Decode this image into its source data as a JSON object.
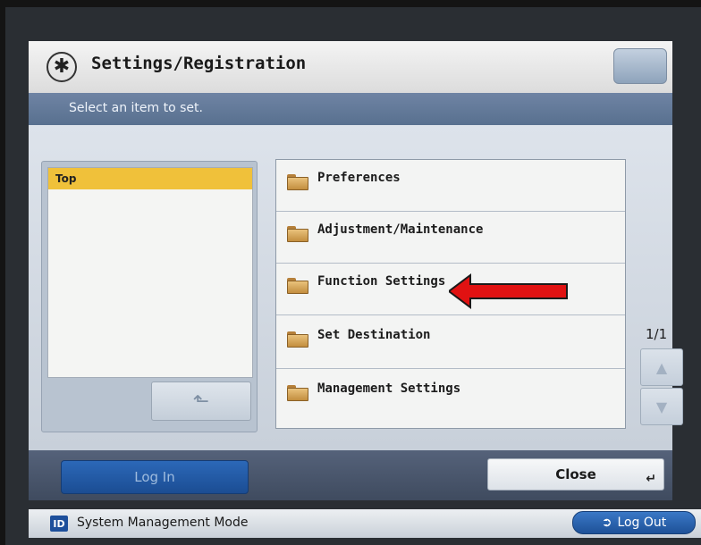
{
  "header": {
    "title": "Settings/Registration",
    "instruction": "Select an item to set."
  },
  "tree": {
    "selected_label": "Top"
  },
  "menu": {
    "items": [
      {
        "label": "Preferences"
      },
      {
        "label": "Adjustment/Maintenance"
      },
      {
        "label": "Function Settings"
      },
      {
        "label": "Set Destination"
      },
      {
        "label": "Management Settings"
      }
    ],
    "page_indicator": "1/1"
  },
  "buttons": {
    "login_label": "Log In",
    "close_label": "Close",
    "logout_label": "Log Out"
  },
  "status": {
    "id_badge": "ID",
    "mode_text": "System Management Mode"
  },
  "colors": {
    "tree_highlight": "#f0c13a",
    "annotation_arrow": "#e11212",
    "login_button": "#1b4d93"
  },
  "icons": [
    "settings-wheel-icon",
    "folder-icon",
    "up-arrow-icon",
    "scroll-up-icon",
    "scroll-down-icon",
    "enter-icon",
    "logout-icon"
  ]
}
